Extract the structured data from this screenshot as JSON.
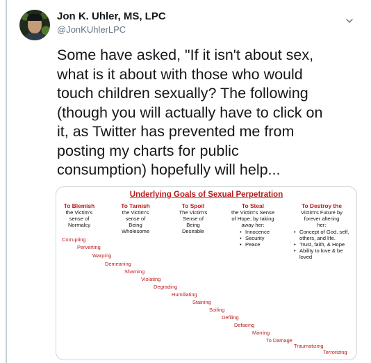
{
  "tweet": {
    "author_name": "Jon K. Uhler, MS, LPC",
    "author_handle": "@JonKUhlerLPC",
    "text_lines": [
      "Some have asked, \"If it isn't about sex,",
      "what is it about with those who would",
      "touch children sexually? The following",
      "(though you will actually have to click on",
      "it, as Twitter has prevented me from",
      "posting my charts for public",
      "consumption) hopefully will help..."
    ]
  },
  "chart_image": {
    "title": "Underlying Goals of Sexual Perpetration",
    "columns": [
      {
        "heading": "To Blemish",
        "lines": [
          "the Victim's",
          "sense of",
          "Normalcy"
        ]
      },
      {
        "heading": "To Tarnish",
        "lines": [
          "the Victim's",
          "sense of",
          "Being",
          "Wholesome"
        ]
      },
      {
        "heading": "To Spoil",
        "lines": [
          "The Victim's",
          "Sense of",
          "Being",
          "Desirable"
        ]
      },
      {
        "heading": "To Steal",
        "lines": [
          "the Victim's Sense",
          "of Hope, by taking",
          "away her:"
        ],
        "bullets": [
          "Innocence",
          "Security",
          "Peace"
        ]
      },
      {
        "heading": "To Destroy the",
        "lines": [
          "Victim's Future by",
          "forever altering",
          "her:"
        ],
        "bullets": [
          "Concept of God, self, others, and life.",
          "Trust, faith, & Hope",
          "Ability to love & be loved"
        ]
      }
    ],
    "stair_terms": [
      "Corrupting",
      "Perverting",
      "Warping",
      "Demeaning",
      "Shaming",
      "Violating",
      "Degrading",
      "Humiliating",
      "Staining",
      "Soiling",
      "Defiling",
      "Defacing",
      "Marring",
      "To Damage",
      "Traumatizing",
      "Terrorizing"
    ]
  },
  "colors": {
    "accent_red": "#b71c1c",
    "handle_gray": "#657786",
    "thread_line": "#c4cfd6",
    "card_border": "#ccd6dd"
  },
  "icons": {
    "menu": "chevron-down-icon"
  }
}
